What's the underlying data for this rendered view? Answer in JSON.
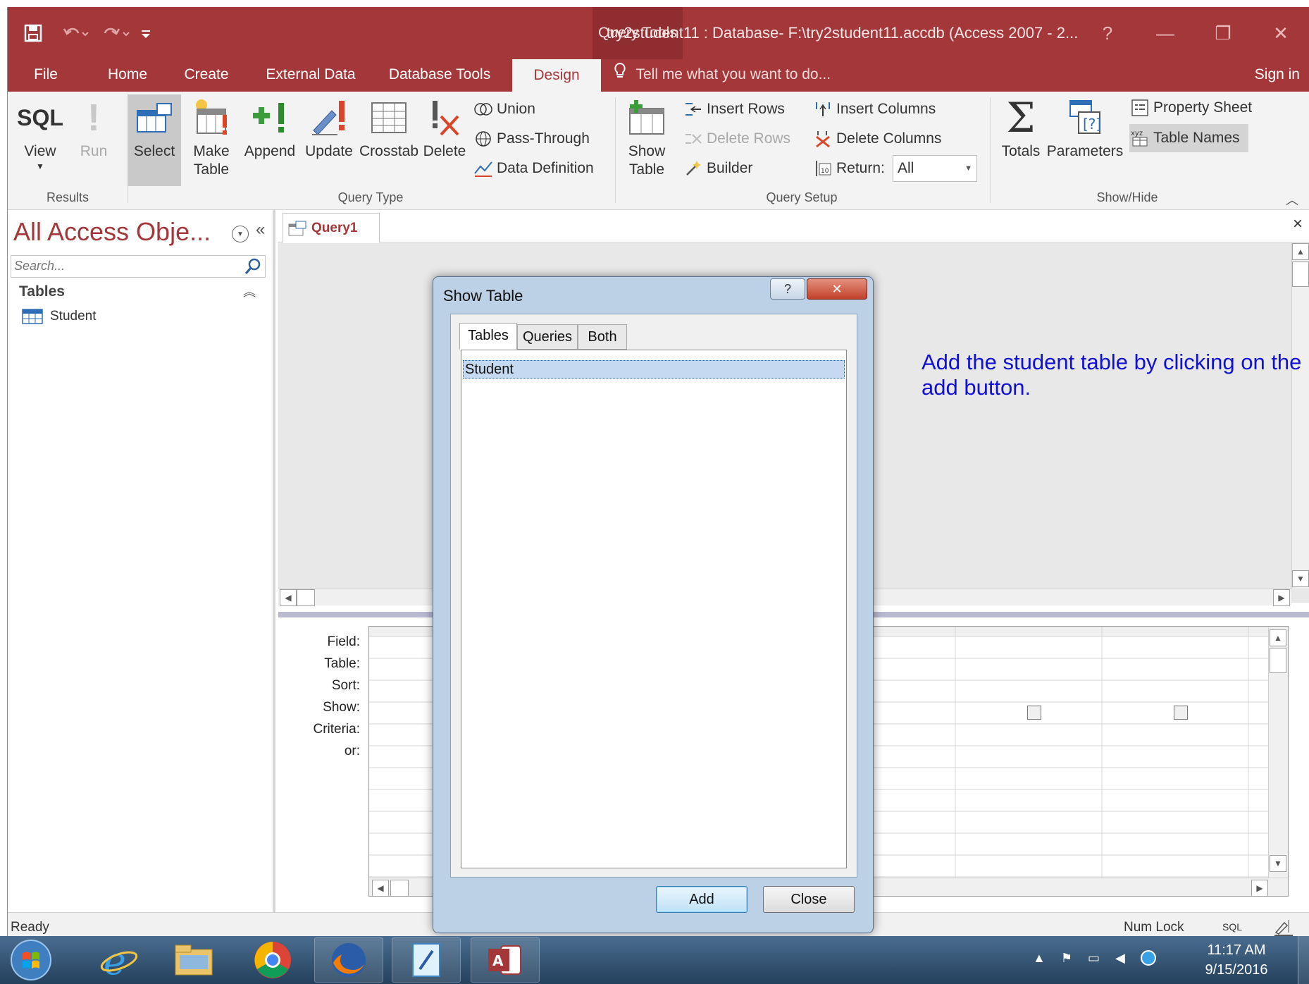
{
  "titlebar": {
    "query_tools_label": "Query Tools",
    "window_title": "try2student11 : Database- F:\\try2student11.accdb (Access 2007 - 2...",
    "help": "?",
    "minimize": "—",
    "restore": "❐",
    "close": "✕"
  },
  "tabs": [
    {
      "label": "File"
    },
    {
      "label": "Home"
    },
    {
      "label": "Create"
    },
    {
      "label": "External Data"
    },
    {
      "label": "Database Tools"
    },
    {
      "label": "Design"
    }
  ],
  "tell_me": "Tell me what you want to do...",
  "sign_in": "Sign in",
  "ribbon": {
    "results": {
      "label": "Results",
      "view_icon": "SQL",
      "view": "View",
      "run": "Run"
    },
    "query_type": {
      "label": "Query Type",
      "select": "Select",
      "make_table": "Make\nTable",
      "append": "Append",
      "update": "Update",
      "crosstab": "Crosstab",
      "delete": "Delete",
      "union": "Union",
      "pass_through": "Pass-Through",
      "data_definition": "Data Definition"
    },
    "query_setup": {
      "label": "Query Setup",
      "show_table": "Show\nTable",
      "insert_rows": "Insert Rows",
      "delete_rows": "Delete Rows",
      "builder": "Builder",
      "insert_columns": "Insert Columns",
      "delete_columns": "Delete Columns",
      "return_label": "Return:",
      "return_value": "All"
    },
    "show_hide": {
      "label": "Show/Hide",
      "totals": "Totals",
      "parameters": "Parameters",
      "property_sheet": "Property Sheet",
      "table_names": "Table Names"
    }
  },
  "navpane": {
    "title": "All Access Obje...",
    "search_placeholder": "Search...",
    "section": "Tables",
    "items": [
      {
        "label": "Student"
      }
    ]
  },
  "document": {
    "tab_label": "Query1",
    "close": "×",
    "grid_labels": [
      "Field:",
      "Table:",
      "Sort:",
      "Show:",
      "Criteria:",
      "or:"
    ]
  },
  "dialog": {
    "title": "Show Table",
    "help": "?",
    "close": "✕",
    "tabs": [
      {
        "label": "Tables"
      },
      {
        "label": "Queries"
      },
      {
        "label": "Both"
      }
    ],
    "items": [
      {
        "label": "Student"
      }
    ],
    "add": "Add",
    "close_button": "Close"
  },
  "annotation": "Add the student table by clicking on the add button.",
  "status": {
    "left": "Ready",
    "num_lock": "Num Lock",
    "sql": "SQL"
  },
  "taskbar": {
    "time": "11:17 AM",
    "date": "9/15/2016"
  },
  "colors": {
    "access_accent": "#a4373a",
    "annotation": "#1010d6",
    "taskbar": "#2f4d6b"
  }
}
